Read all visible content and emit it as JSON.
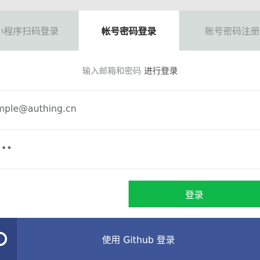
{
  "tabs": [
    {
      "label": "小程序扫码登录",
      "active": false
    },
    {
      "label": "帐号密码登录",
      "active": true
    },
    {
      "label": "账号密码注册",
      "active": false
    }
  ],
  "hint": {
    "text": "输入邮箱和密码",
    "strong": "进行登录"
  },
  "email": {
    "value": "mple@authing.cn"
  },
  "password": {
    "value": "•••"
  },
  "login_button": {
    "label": "登录"
  },
  "github_button": {
    "label": "使用 Github 登录"
  },
  "colors": {
    "tab_bar": "#d6dcd9",
    "active_tab": "#ffffff",
    "primary_green": "#10b84a",
    "github_blue": "#3e5697",
    "github_icon_bg": "#2f4480"
  },
  "icons": {
    "github": "github-icon"
  }
}
